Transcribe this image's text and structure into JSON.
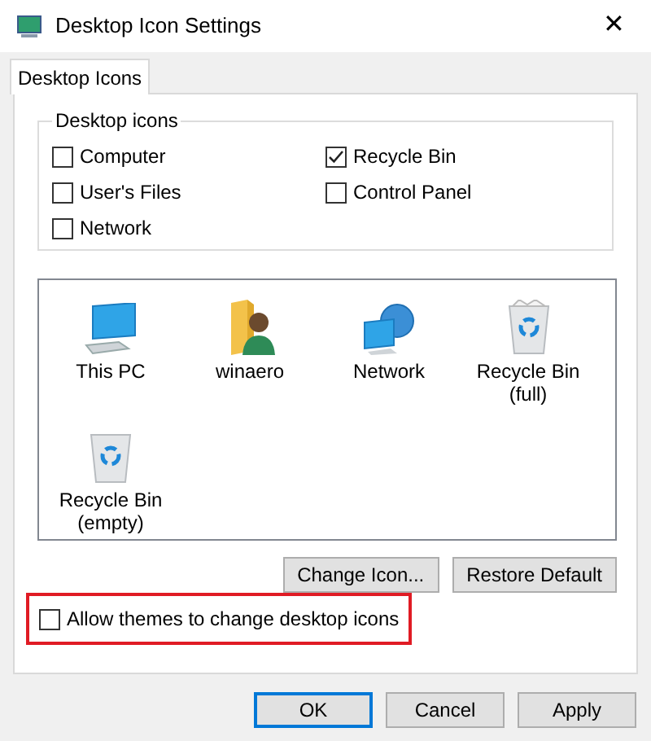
{
  "window": {
    "title": "Desktop Icon Settings",
    "close": "✕"
  },
  "tabs": [
    {
      "label": "Desktop Icons",
      "selected": true
    }
  ],
  "group": {
    "title": "Desktop icons",
    "checkboxes": [
      {
        "label": "Computer",
        "checked": false
      },
      {
        "label": "Recycle Bin",
        "checked": true
      },
      {
        "label": "User's Files",
        "checked": false
      },
      {
        "label": "Control Panel",
        "checked": false
      },
      {
        "label": "Network",
        "checked": false
      }
    ]
  },
  "icons": [
    {
      "kind": "pc",
      "label": "This PC",
      "selected": false
    },
    {
      "kind": "user-folder",
      "label": "winaero",
      "selected": false
    },
    {
      "kind": "network",
      "label": "Network",
      "selected": false
    },
    {
      "kind": "bin-full",
      "label": "Recycle Bin (full)",
      "selected": false
    },
    {
      "kind": "bin-empty",
      "label": "Recycle Bin (empty)",
      "selected": false
    }
  ],
  "icon_buttons": [
    "Change Icon...",
    "Restore Default"
  ],
  "allow_themes": {
    "label": "Allow themes to change desktop icons",
    "checked": false,
    "highlighted": true
  },
  "buttons": [
    {
      "label": "OK",
      "default": true
    },
    {
      "label": "Cancel",
      "default": false
    },
    {
      "label": "Apply",
      "default": false
    }
  ]
}
